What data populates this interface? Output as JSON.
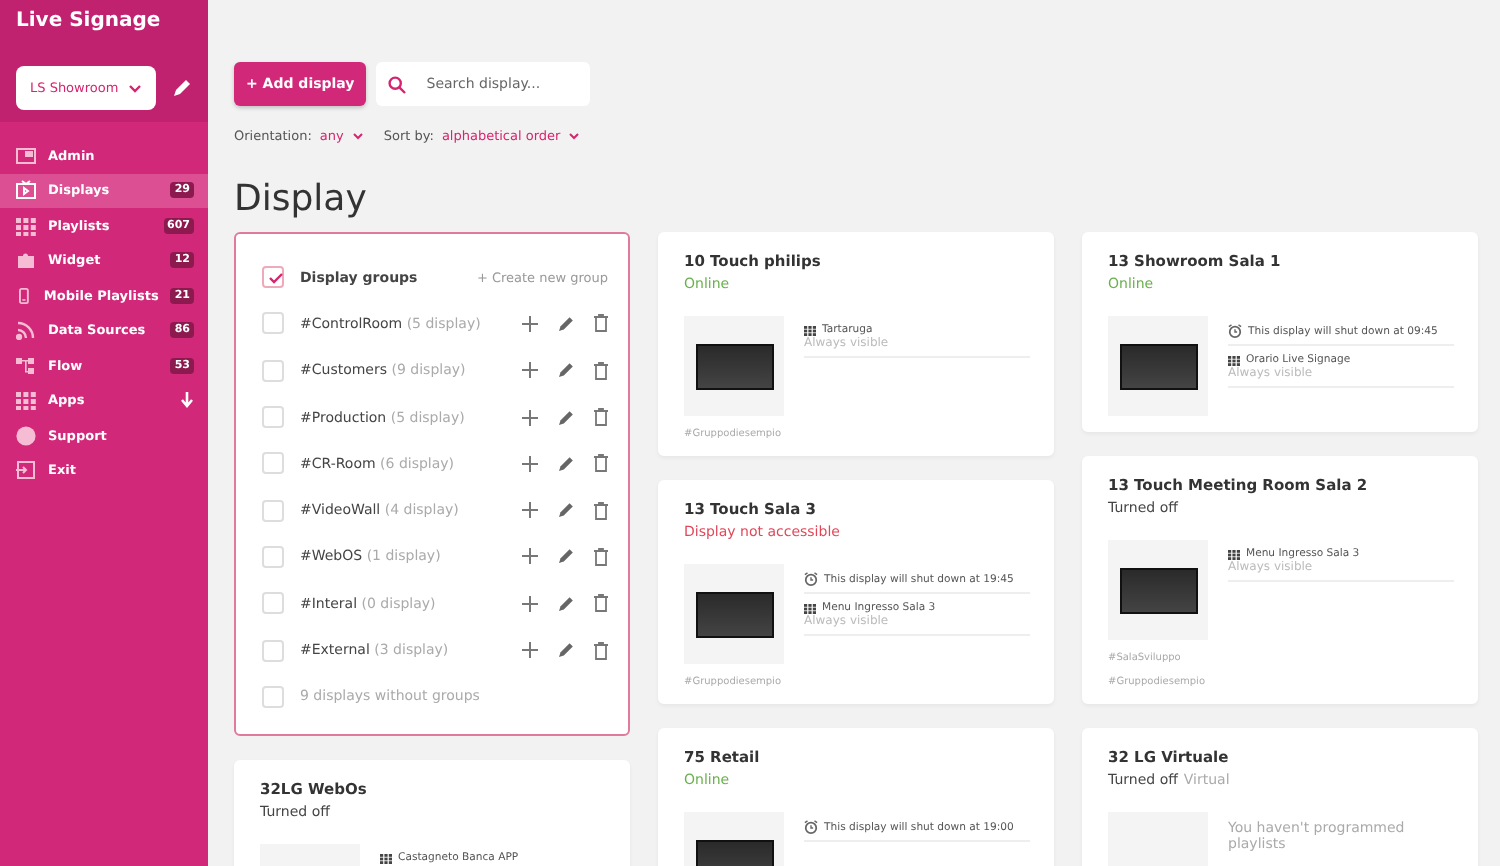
{
  "sidebar": {
    "title": "Live Signage",
    "workspace": "LS Showroom",
    "items": [
      {
        "label": "Admin",
        "selected": false
      },
      {
        "label": "Displays",
        "badge": "29",
        "selected": true
      },
      {
        "label": "Playlists",
        "badge": "607",
        "selected": false
      },
      {
        "label": "Widget",
        "badge": "12",
        "selected": false
      },
      {
        "label": "Mobile Playlists",
        "badge": "21",
        "selected": false
      },
      {
        "label": "Data Sources",
        "badge": "86",
        "selected": false
      },
      {
        "label": "Flow",
        "badge": "53",
        "selected": false
      },
      {
        "label": "Apps",
        "expandable": true,
        "selected": false
      },
      {
        "label": "Support",
        "selected": false
      },
      {
        "label": "Exit",
        "selected": false
      }
    ]
  },
  "toolbar": {
    "add_button": "+ Add display",
    "search": {
      "placeholder": "Search display..."
    },
    "filters": [
      {
        "label": "Orientation:",
        "value": "any"
      },
      {
        "label": "Sort by:",
        "value": "alphabetical order"
      }
    ]
  },
  "page_title": "Display",
  "groups": {
    "title": "Display groups",
    "checked": true,
    "create": "+ Create new group",
    "items": [
      {
        "name": "#ControlRoom",
        "count": "(5 display)",
        "checked": false
      },
      {
        "name": "#Customers",
        "count": "(9 display)",
        "checked": false
      },
      {
        "name": "#Production",
        "count": "(5 display)",
        "checked": false
      },
      {
        "name": "#CR-Room",
        "count": "(6 display)",
        "checked": false
      },
      {
        "name": "#VideoWall",
        "count": "(4 display)",
        "checked": false
      },
      {
        "name": "#WebOS",
        "count": "(1 display)",
        "checked": false
      },
      {
        "name": "#Interal",
        "count": "(0 display)",
        "checked": false
      },
      {
        "name": "#External",
        "count": "(3 display)",
        "checked": false
      }
    ],
    "ungrouped": {
      "label": "9 displays without groups",
      "checked": false
    }
  },
  "columns": [
    [
      {
        "name": "32LG WebOs",
        "status": "Turned off",
        "color": "#444444",
        "lines": [
          {
            "kind": "playlist",
            "text": "Castagneto Banca APP"
          }
        ]
      }
    ],
    [
      {
        "name": "10 Touch philips",
        "status": "Online",
        "color": "#6ab04c",
        "preview": true,
        "lines": [
          {
            "kind": "playlist",
            "text": "Tartaruga",
            "sub": "Always visible"
          }
        ],
        "tags": [
          "#Gruppodiesempio"
        ]
      },
      {
        "name": "13 Touch Sala 3",
        "status": "Display not accessible",
        "color": "#e0485a",
        "preview": true,
        "lines": [
          {
            "kind": "shutdown",
            "text": "This display will shut down at 19:45"
          },
          {
            "kind": "playlist",
            "text": "Menu Ingresso Sala 3",
            "sub": "Always visible"
          }
        ],
        "tags": [
          "#Gruppodiesempio"
        ]
      },
      {
        "name": "75 Retail",
        "status": "Online",
        "color": "#6ab04c",
        "preview": true,
        "lines": [
          {
            "kind": "shutdown",
            "text": "This display will shut down at 19:00"
          }
        ]
      }
    ],
    [
      {
        "name": "13 Showroom Sala 1",
        "status": "Online",
        "color": "#6ab04c",
        "preview": true,
        "lines": [
          {
            "kind": "shutdown",
            "text": "This display will shut down at 09:45"
          },
          {
            "kind": "playlist",
            "text": "Orario Live Signage",
            "sub": "Always visible"
          }
        ]
      },
      {
        "name": "13 Touch Meeting Room Sala 2",
        "status": "Turned off",
        "color": "#444444",
        "preview": true,
        "lines": [
          {
            "kind": "playlist",
            "text": "Menu Ingresso Sala 3",
            "sub": "Always visible"
          }
        ],
        "tags": [
          "#SalaSviluppo",
          "#Gruppodiesempio"
        ]
      },
      {
        "name": "32 LG Virtuale",
        "status": "Turned off",
        "color": "#444444",
        "virtual": "Virtual",
        "preview": false,
        "lines": [
          {
            "kind": "note",
            "text": "You haven't programmed playlists"
          }
        ]
      }
    ]
  ]
}
